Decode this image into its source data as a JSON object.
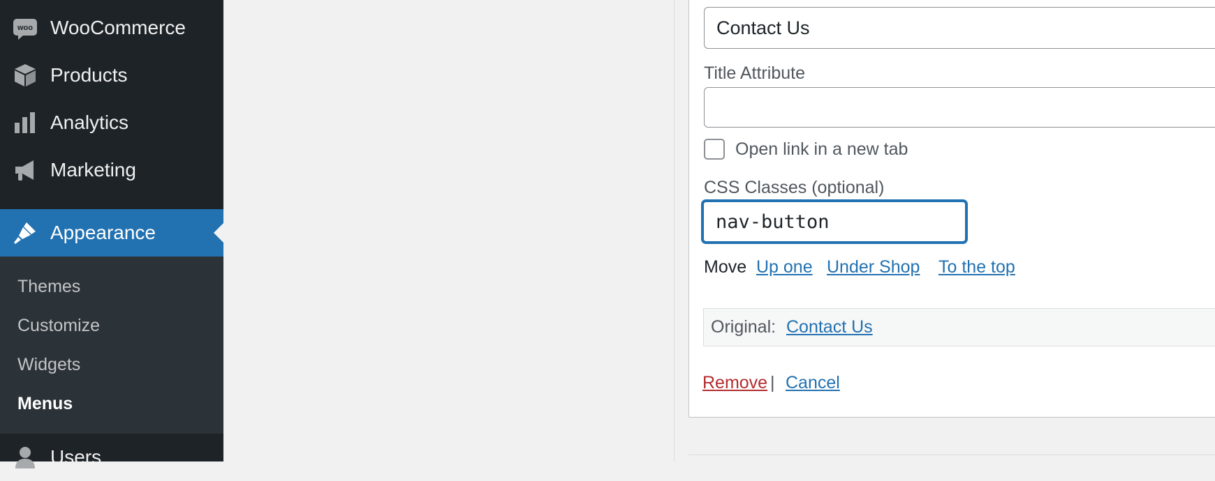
{
  "sidebar": {
    "items": [
      {
        "label": "WooCommerce",
        "icon": "woo-icon"
      },
      {
        "label": "Products",
        "icon": "cube-icon"
      },
      {
        "label": "Analytics",
        "icon": "bar-chart-icon"
      },
      {
        "label": "Marketing",
        "icon": "megaphone-icon"
      },
      {
        "label": "Appearance",
        "icon": "paintbrush-icon",
        "current": true
      }
    ],
    "submenu": [
      {
        "label": "Themes"
      },
      {
        "label": "Customize"
      },
      {
        "label": "Widgets"
      },
      {
        "label": "Menus",
        "current": true
      }
    ],
    "next_item": {
      "label": "Users",
      "icon": "user-icon"
    },
    "woo_icon_text": "woo"
  },
  "menu_item_panel": {
    "navigation_label_value": "Contact Us",
    "title_attribute_label": "Title Attribute",
    "title_attribute_value": "",
    "new_tab_label": "Open link in a new tab",
    "new_tab_checked": false,
    "css_classes_label": "CSS Classes (optional)",
    "css_classes_value": "nav-button",
    "move_label": "Move",
    "move_links": [
      "Up one",
      "Under Shop",
      "To the top"
    ],
    "original_label": "Original:",
    "original_link": "Contact Us",
    "remove_label": "Remove",
    "separator": "|",
    "cancel_label": "Cancel"
  },
  "colors": {
    "sidebar_bg": "#1d2327",
    "submenu_bg": "#2c3338",
    "accent": "#2271b1",
    "danger": "#b32d2e"
  }
}
